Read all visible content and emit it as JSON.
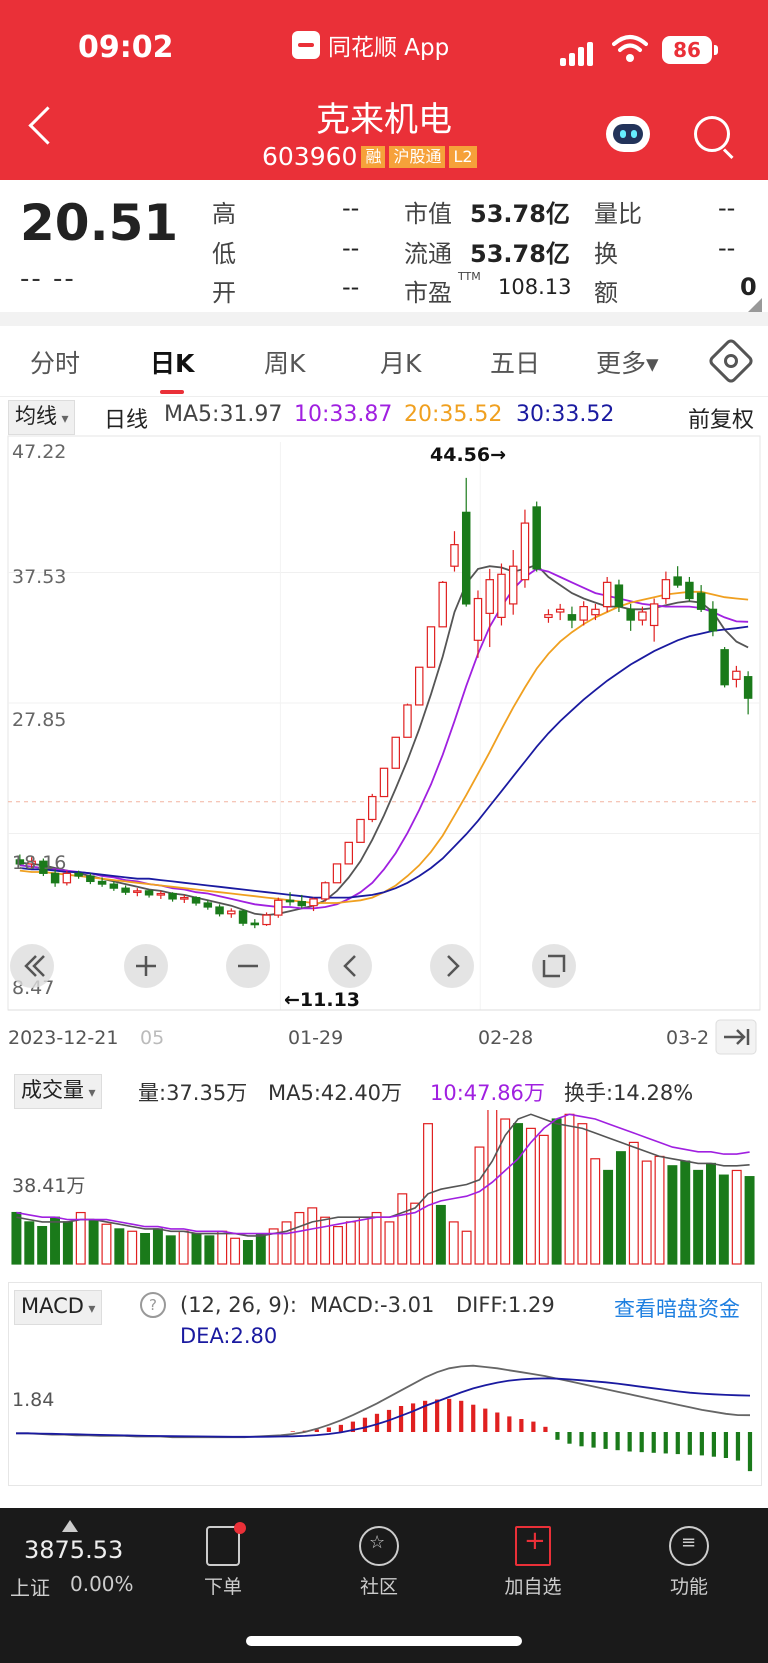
{
  "status": {
    "time": "09:02",
    "app_name": "同花顺 App",
    "battery": "86"
  },
  "header": {
    "stock_name": "克来机电",
    "stock_code": "603960",
    "tags": [
      "融",
      "沪股通",
      "L2"
    ]
  },
  "quote": {
    "price": "20.51",
    "change": "-- --",
    "high_label": "高",
    "high": "--",
    "low_label": "低",
    "low": "--",
    "open_label": "开",
    "open": "--",
    "mcap_label": "市值",
    "mcap": "53.78亿",
    "float_label": "流通",
    "float": "53.78亿",
    "pe_label": "市盈",
    "pe_sup": "TTM",
    "pe": "108.13",
    "vr_label": "量比",
    "vr": "--",
    "turn_label": "换",
    "turn": "--",
    "amt_label": "额",
    "amt": "0"
  },
  "tabs": [
    "分时",
    "日K",
    "周K",
    "月K",
    "五日",
    "更多▾"
  ],
  "ma": {
    "selector": "均线",
    "period": "日线",
    "ma5": "MA5:31.97",
    "ma10": "10:33.87",
    "ma20": "20:35.52",
    "ma30": "30:33.52",
    "adjust": "前复权"
  },
  "kline": {
    "y_labels": [
      "47.22",
      "37.53",
      "27.85",
      "18.16",
      "8.47"
    ],
    "high_marker": "44.56→",
    "low_marker": "←11.13",
    "x_labels": [
      "2023-12-21",
      "05",
      "01-29",
      "02-28",
      "03-2"
    ]
  },
  "volume": {
    "selector": "成交量",
    "vol": "量:37.35万",
    "ma5": "MA5:42.40万",
    "ma10": "10:47.86万",
    "turnover": "换手:14.28%",
    "y_label": "38.41万"
  },
  "macd": {
    "selector": "MACD",
    "params": "(12, 26, 9):",
    "macd": "MACD:-3.01",
    "diff": "DIFF:1.29",
    "dea": "DEA:2.80",
    "link": "查看暗盘资金",
    "y_label": "1.84"
  },
  "bottom": {
    "index_value": "3875.53",
    "index_name": "上证",
    "index_change": "0.00%",
    "nav": [
      "下单",
      "社区",
      "加自选",
      "功能"
    ]
  },
  "colors": {
    "brand": "#ea3038",
    "up": "#e02020",
    "down": "#1a7a1a",
    "ma5": "#555555",
    "ma10": "#a020e0",
    "ma20": "#f0a020",
    "ma30": "#1a1aa0"
  },
  "chart_data": [
    {
      "type": "candlestick",
      "title": "",
      "ylim": [
        8.47,
        47.22
      ],
      "x_tick_labels": [
        "2023-12-21",
        "05",
        "01-29",
        "02-28",
        "03-2"
      ],
      "candles": [
        {
          "o": 16.2,
          "h": 16.6,
          "l": 15.8,
          "c": 15.9
        },
        {
          "o": 15.9,
          "h": 16.4,
          "l": 15.6,
          "c": 16.1
        },
        {
          "o": 16.1,
          "h": 16.3,
          "l": 15.0,
          "c": 15.2
        },
        {
          "o": 15.2,
          "h": 15.5,
          "l": 14.2,
          "c": 14.5
        },
        {
          "o": 14.5,
          "h": 15.4,
          "l": 14.3,
          "c": 15.2
        },
        {
          "o": 15.2,
          "h": 15.4,
          "l": 14.8,
          "c": 15.0
        },
        {
          "o": 15.0,
          "h": 15.2,
          "l": 14.4,
          "c": 14.6
        },
        {
          "o": 14.6,
          "h": 14.9,
          "l": 14.2,
          "c": 14.4
        },
        {
          "o": 14.4,
          "h": 14.6,
          "l": 13.9,
          "c": 14.1
        },
        {
          "o": 14.1,
          "h": 14.3,
          "l": 13.6,
          "c": 13.8
        },
        {
          "o": 13.8,
          "h": 14.1,
          "l": 13.5,
          "c": 13.9
        },
        {
          "o": 13.9,
          "h": 14.0,
          "l": 13.4,
          "c": 13.6
        },
        {
          "o": 13.6,
          "h": 13.9,
          "l": 13.3,
          "c": 13.7
        },
        {
          "o": 13.7,
          "h": 13.8,
          "l": 13.1,
          "c": 13.3
        },
        {
          "o": 13.3,
          "h": 13.6,
          "l": 13.0,
          "c": 13.4
        },
        {
          "o": 13.4,
          "h": 13.5,
          "l": 12.8,
          "c": 13.0
        },
        {
          "o": 13.0,
          "h": 13.2,
          "l": 12.5,
          "c": 12.7
        },
        {
          "o": 12.7,
          "h": 12.9,
          "l": 12.0,
          "c": 12.2
        },
        {
          "o": 12.2,
          "h": 12.6,
          "l": 11.9,
          "c": 12.4
        },
        {
          "o": 12.4,
          "h": 12.5,
          "l": 11.3,
          "c": 11.5
        },
        {
          "o": 11.5,
          "h": 11.8,
          "l": 11.13,
          "c": 11.4
        },
        {
          "o": 11.4,
          "h": 12.3,
          "l": 11.3,
          "c": 12.1
        },
        {
          "o": 12.1,
          "h": 13.4,
          "l": 11.9,
          "c": 13.2
        },
        {
          "o": 13.2,
          "h": 13.8,
          "l": 12.8,
          "c": 13.1
        },
        {
          "o": 13.1,
          "h": 13.6,
          "l": 12.6,
          "c": 12.8
        },
        {
          "o": 12.8,
          "h": 13.4,
          "l": 12.4,
          "c": 13.3
        },
        {
          "o": 13.3,
          "h": 14.6,
          "l": 13.1,
          "c": 14.5
        },
        {
          "o": 14.5,
          "h": 15.9,
          "l": 14.5,
          "c": 15.9
        },
        {
          "o": 15.9,
          "h": 17.5,
          "l": 15.9,
          "c": 17.5
        },
        {
          "o": 17.5,
          "h": 19.2,
          "l": 17.5,
          "c": 19.2
        },
        {
          "o": 19.2,
          "h": 21.1,
          "l": 19.0,
          "c": 20.9
        },
        {
          "o": 20.9,
          "h": 23.0,
          "l": 20.9,
          "c": 23.0
        },
        {
          "o": 23.0,
          "h": 25.3,
          "l": 23.0,
          "c": 25.3
        },
        {
          "o": 25.3,
          "h": 27.8,
          "l": 25.3,
          "c": 27.7
        },
        {
          "o": 27.7,
          "h": 30.5,
          "l": 27.7,
          "c": 30.5
        },
        {
          "o": 30.5,
          "h": 33.5,
          "l": 30.5,
          "c": 33.5
        },
        {
          "o": 33.5,
          "h": 36.9,
          "l": 33.5,
          "c": 36.8
        },
        {
          "o": 38.0,
          "h": 40.6,
          "l": 37.6,
          "c": 39.6
        },
        {
          "o": 42.0,
          "h": 44.56,
          "l": 35.0,
          "c": 35.2
        },
        {
          "o": 32.5,
          "h": 36.2,
          "l": 31.2,
          "c": 35.6
        },
        {
          "o": 34.5,
          "h": 37.8,
          "l": 32.0,
          "c": 37.0
        },
        {
          "o": 34.2,
          "h": 38.2,
          "l": 33.6,
          "c": 37.4
        },
        {
          "o": 35.2,
          "h": 39.2,
          "l": 34.4,
          "c": 38.0
        },
        {
          "o": 37.0,
          "h": 42.2,
          "l": 36.4,
          "c": 41.2
        },
        {
          "o": 42.4,
          "h": 42.8,
          "l": 37.6,
          "c": 37.8
        },
        {
          "o": 34.2,
          "h": 34.8,
          "l": 33.8,
          "c": 34.4
        },
        {
          "o": 34.6,
          "h": 35.2,
          "l": 34.0,
          "c": 34.8
        },
        {
          "o": 34.4,
          "h": 35.0,
          "l": 33.4,
          "c": 34.0
        },
        {
          "o": 34.0,
          "h": 35.4,
          "l": 33.6,
          "c": 35.0
        },
        {
          "o": 34.4,
          "h": 35.2,
          "l": 34.0,
          "c": 34.8
        },
        {
          "o": 35.0,
          "h": 37.2,
          "l": 34.6,
          "c": 36.8
        },
        {
          "o": 36.6,
          "h": 37.0,
          "l": 34.6,
          "c": 35.0
        },
        {
          "o": 34.8,
          "h": 35.2,
          "l": 33.2,
          "c": 34.0
        },
        {
          "o": 34.0,
          "h": 35.0,
          "l": 33.6,
          "c": 34.6
        },
        {
          "o": 33.6,
          "h": 35.6,
          "l": 32.4,
          "c": 35.2
        },
        {
          "o": 35.6,
          "h": 37.6,
          "l": 35.2,
          "c": 37.0
        },
        {
          "o": 37.2,
          "h": 38.0,
          "l": 36.4,
          "c": 36.6
        },
        {
          "o": 36.8,
          "h": 37.2,
          "l": 35.4,
          "c": 35.6
        },
        {
          "o": 36.0,
          "h": 36.6,
          "l": 34.6,
          "c": 34.8
        },
        {
          "o": 34.8,
          "h": 35.4,
          "l": 32.8,
          "c": 33.2
        },
        {
          "o": 31.8,
          "h": 32.0,
          "l": 29.0,
          "c": 29.2
        },
        {
          "o": 29.6,
          "h": 30.6,
          "l": 29.0,
          "c": 30.2
        },
        {
          "o": 29.8,
          "h": 30.2,
          "l": 27.0,
          "c": 28.2
        }
      ],
      "series": [
        {
          "name": "MA5",
          "values": [
            16.0,
            15.9,
            15.8,
            15.6,
            15.4,
            15.2,
            15.0,
            14.8,
            14.6,
            14.4,
            14.2,
            14.0,
            13.9,
            13.7,
            13.6,
            13.4,
            13.2,
            13.0,
            12.8,
            12.5,
            12.2,
            12.1,
            12.2,
            12.4,
            12.6,
            12.8,
            13.2,
            13.9,
            14.9,
            16.1,
            17.7,
            19.5,
            21.5,
            23.6,
            25.9,
            28.5,
            31.3,
            34.6,
            36.7,
            37.8,
            38.0,
            37.9,
            37.6,
            37.8,
            38.1,
            37.2,
            36.6,
            36.0,
            35.6,
            35.3,
            35.0,
            35.0,
            34.8,
            34.8,
            34.9,
            35.1,
            35.3,
            35.4,
            35.3,
            34.6,
            33.3,
            32.4,
            31.97
          ]
        },
        {
          "name": "MA10",
          "values": [
            15.8,
            15.7,
            15.6,
            15.5,
            15.4,
            15.3,
            15.2,
            15.0,
            14.9,
            14.7,
            14.6,
            14.4,
            14.3,
            14.1,
            14.0,
            13.8,
            13.7,
            13.5,
            13.3,
            13.1,
            12.9,
            12.8,
            12.7,
            12.7,
            12.6,
            12.6,
            12.7,
            12.9,
            13.3,
            13.8,
            14.5,
            15.5,
            16.7,
            18.2,
            19.9,
            21.8,
            24.0,
            26.5,
            29.1,
            31.5,
            33.5,
            35.0,
            36.3,
            37.2,
            37.8,
            37.6,
            37.2,
            36.8,
            36.4,
            36.0,
            35.8,
            35.6,
            35.4,
            35.2,
            35.1,
            35.0,
            35.0,
            35.0,
            34.9,
            34.6,
            34.2,
            33.9,
            33.87
          ]
        },
        {
          "name": "MA20",
          "values": [
            15.4,
            15.3,
            15.3,
            15.2,
            15.1,
            15.0,
            14.9,
            14.8,
            14.7,
            14.6,
            14.5,
            14.4,
            14.3,
            14.2,
            14.1,
            14.0,
            13.9,
            13.8,
            13.7,
            13.6,
            13.5,
            13.4,
            13.3,
            13.2,
            13.1,
            13.0,
            13.0,
            13.0,
            13.1,
            13.2,
            13.4,
            13.8,
            14.3,
            15.0,
            15.8,
            16.8,
            18.0,
            19.5,
            21.0,
            22.6,
            24.2,
            25.9,
            27.5,
            29.0,
            30.4,
            31.5,
            32.4,
            33.1,
            33.7,
            34.2,
            34.6,
            35.0,
            35.3,
            35.5,
            35.7,
            35.9,
            36.0,
            36.1,
            36.1,
            35.9,
            35.7,
            35.6,
            35.52
          ]
        },
        {
          "name": "MA30",
          "values": [
            15.6,
            15.5,
            15.5,
            15.4,
            15.3,
            15.3,
            15.2,
            15.1,
            15.0,
            14.9,
            14.8,
            14.8,
            14.7,
            14.6,
            14.5,
            14.4,
            14.3,
            14.2,
            14.1,
            14.0,
            13.9,
            13.8,
            13.7,
            13.6,
            13.5,
            13.4,
            13.4,
            13.4,
            13.4,
            13.5,
            13.6,
            13.8,
            14.1,
            14.5,
            15.0,
            15.6,
            16.3,
            17.2,
            18.1,
            19.1,
            20.2,
            21.3,
            22.4,
            23.5,
            24.6,
            25.6,
            26.5,
            27.3,
            28.1,
            28.8,
            29.5,
            30.1,
            30.7,
            31.2,
            31.7,
            32.1,
            32.5,
            32.8,
            33.0,
            33.2,
            33.3,
            33.4,
            33.52
          ]
        }
      ]
    },
    {
      "type": "bar",
      "title": "",
      "ylim": [
        0,
        65
      ],
      "unit": "万",
      "values": [
        22,
        18,
        16,
        20,
        18,
        22,
        19,
        17,
        15,
        14,
        13,
        15,
        12,
        14,
        13,
        12,
        14,
        11,
        10,
        13,
        15,
        18,
        22,
        24,
        20,
        16,
        18,
        20,
        22,
        18,
        30,
        26,
        60,
        25,
        18,
        14,
        50,
        80,
        62,
        60,
        58,
        55,
        62,
        64,
        60,
        45,
        40,
        48,
        52,
        44,
        46,
        42,
        44,
        40,
        43,
        38,
        40,
        37.35
      ],
      "series": [
        {
          "name": "MA5",
          "values": [
            20,
            19,
            18,
            18,
            18,
            19,
            19,
            18,
            17,
            16,
            15,
            15,
            14,
            14,
            13,
            13,
            13,
            13,
            12,
            12,
            13,
            14,
            16,
            18,
            19,
            20,
            20,
            20,
            20,
            20,
            22,
            24,
            30,
            32,
            33,
            34,
            36,
            44,
            55,
            62,
            64,
            62,
            60,
            59,
            58,
            56,
            54,
            52,
            50,
            48,
            46,
            45,
            44,
            43,
            43,
            42,
            42,
            42.4
          ]
        },
        {
          "name": "MA10",
          "values": [
            22,
            21,
            20,
            20,
            19,
            19,
            19,
            19,
            18,
            17,
            16,
            16,
            15,
            15,
            14,
            14,
            14,
            13,
            13,
            13,
            13,
            13,
            14,
            15,
            16,
            17,
            18,
            19,
            20,
            20,
            21,
            22,
            25,
            27,
            28,
            29,
            31,
            35,
            40,
            45,
            52,
            58,
            62,
            64,
            63,
            62,
            60,
            58,
            56,
            54,
            52,
            50,
            49,
            48,
            48,
            47,
            47,
            47.86
          ]
        }
      ]
    },
    {
      "type": "bar",
      "title": "",
      "unit": "MACD",
      "values": [
        0,
        0,
        0,
        0,
        0,
        0,
        0,
        0,
        0,
        0,
        0,
        0,
        0,
        0,
        0,
        0,
        0,
        0,
        0,
        0,
        0,
        0,
        0,
        0.05,
        0.1,
        0.2,
        0.35,
        0.55,
        0.8,
        1.1,
        1.4,
        1.7,
        2.0,
        2.2,
        2.4,
        2.5,
        2.55,
        2.4,
        2.1,
        1.8,
        1.5,
        1.2,
        1.0,
        0.8,
        0.4,
        -0.6,
        -0.9,
        -1.1,
        -1.2,
        -1.3,
        -1.4,
        -1.5,
        -1.55,
        -1.6,
        -1.65,
        -1.7,
        -1.75,
        -1.8,
        -1.9,
        -2.0,
        -2.2,
        -3.01
      ],
      "series": [
        {
          "name": "DIFF",
          "values": [
            -0.1,
            -0.1,
            -0.15,
            -0.2,
            -0.2,
            -0.25,
            -0.25,
            -0.3,
            -0.3,
            -0.3,
            -0.35,
            -0.35,
            -0.35,
            -0.4,
            -0.4,
            -0.4,
            -0.4,
            -0.4,
            -0.4,
            -0.4,
            -0.35,
            -0.3,
            -0.25,
            -0.15,
            0,
            0.25,
            0.55,
            0.9,
            1.3,
            1.75,
            2.2,
            2.7,
            3.2,
            3.7,
            4.2,
            4.6,
            4.9,
            5.05,
            5.1,
            5.0,
            4.9,
            4.75,
            4.6,
            4.45,
            4.3,
            4.1,
            3.9,
            3.7,
            3.5,
            3.3,
            3.1,
            2.9,
            2.7,
            2.5,
            2.3,
            2.1,
            1.9,
            1.7,
            1.55,
            1.4,
            1.3,
            1.29
          ]
        },
        {
          "name": "DEA",
          "values": [
            -0.1,
            -0.1,
            -0.12,
            -0.14,
            -0.16,
            -0.18,
            -0.2,
            -0.22,
            -0.24,
            -0.26,
            -0.28,
            -0.3,
            -0.31,
            -0.32,
            -0.33,
            -0.34,
            -0.35,
            -0.36,
            -0.37,
            -0.37,
            -0.37,
            -0.36,
            -0.35,
            -0.33,
            -0.3,
            -0.24,
            -0.15,
            -0.03,
            0.15,
            0.35,
            0.6,
            0.9,
            1.25,
            1.6,
            2.0,
            2.35,
            2.7,
            3.05,
            3.35,
            3.6,
            3.8,
            3.95,
            4.05,
            4.1,
            4.12,
            4.1,
            4.05,
            3.98,
            3.9,
            3.82,
            3.72,
            3.6,
            3.48,
            3.36,
            3.24,
            3.12,
            3.02,
            2.95,
            2.9,
            2.85,
            2.82,
            2.8
          ]
        }
      ]
    }
  ]
}
